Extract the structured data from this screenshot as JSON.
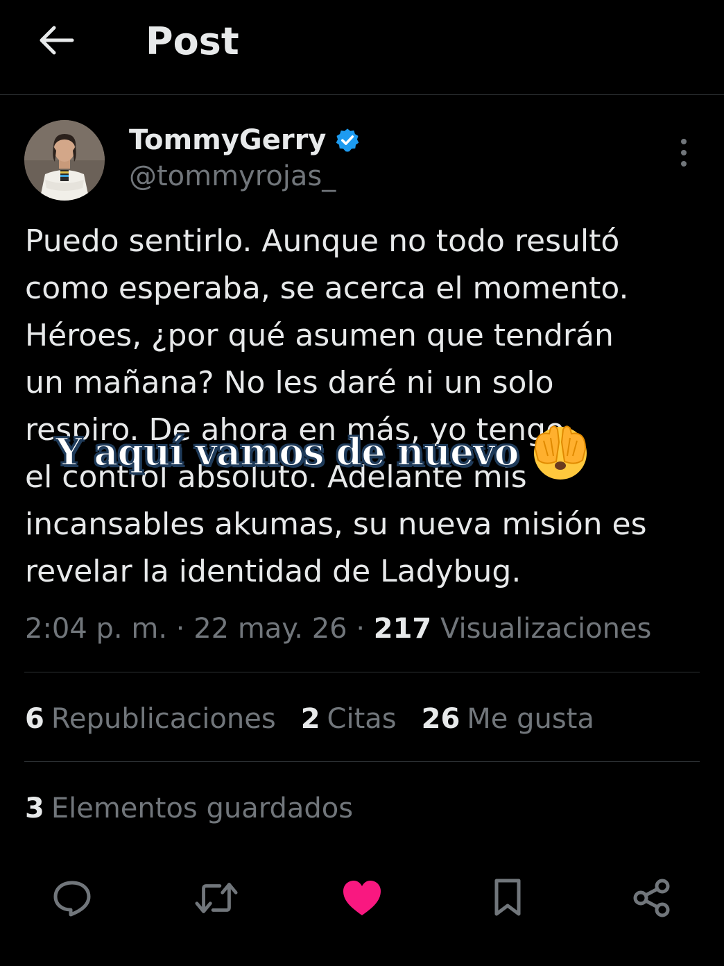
{
  "header": {
    "title": "Post",
    "back_icon": "arrow-left-icon"
  },
  "author": {
    "display_name": "TommyGerry",
    "handle": "@tommyrojas_",
    "verified": true,
    "verified_color": "#1d9bf0"
  },
  "post": {
    "text": "Puedo sentirlo. Aunque no todo resultó\ncomo esperaba, se acerca el momento.\nHéroes, ¿por qué asumen que tendrán\nun mañana? No les daré ni un solo\nrespiro. De ahora en más, yo tengo\nel control absoluto. Adelante mis\nincansables akumas, su nueva misión es\nrevelar la identidad de Ladybug.",
    "time": "2:04 p. m.",
    "date": "22 may. 26",
    "views_count": "217",
    "views_label": "Visualizaciones"
  },
  "overlay": {
    "caption": "Y aquí vamos de nuevo",
    "emoji": "🫣"
  },
  "stats": {
    "reposts_count": "6",
    "reposts_label": "Republicaciones",
    "quotes_count": "2",
    "quotes_label": "Citas",
    "likes_count": "26",
    "likes_label": "Me gusta"
  },
  "bookmarks": {
    "count": "3",
    "label": "Elementos guardados"
  },
  "actions": {
    "reply_icon": "speech-bubble-icon",
    "repost_icon": "repost-icon",
    "like_icon": "heart-icon",
    "bookmark_icon": "bookmark-icon",
    "share_icon": "share-icon"
  },
  "colors": {
    "background": "#000000",
    "text_primary": "#e7e9ea",
    "text_secondary": "#71767b",
    "divider": "#2f3336",
    "like_active": "#f91880"
  }
}
